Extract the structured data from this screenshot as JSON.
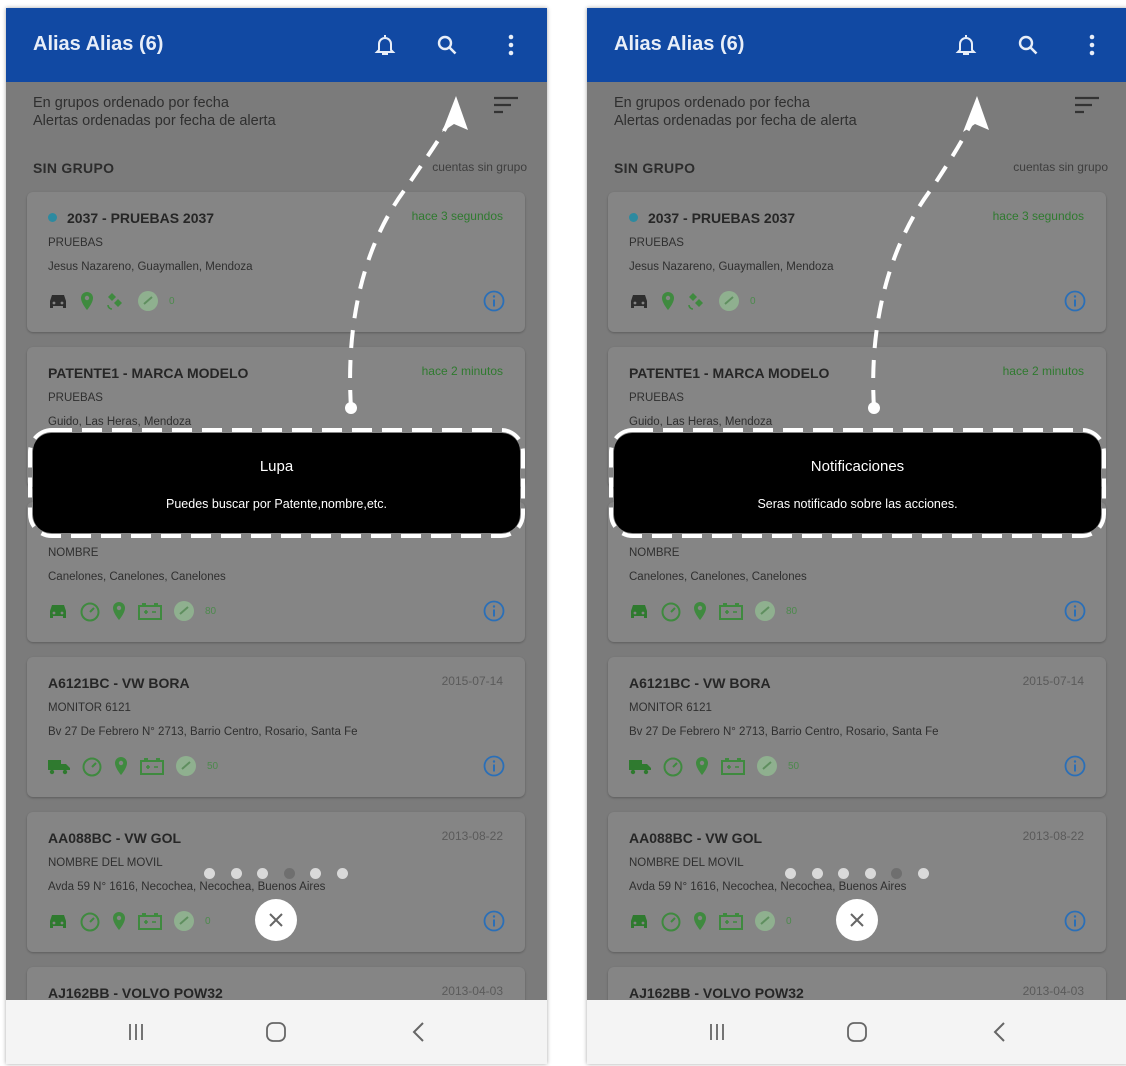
{
  "colors": {
    "appbar": "#1149a3",
    "recent_time": "#2f7a2f",
    "icon_green": "#3f8a3f",
    "info_blue": "#2a6fb8",
    "dot_blue": "#2d8aa0",
    "tooltip_bg": "#000000"
  },
  "screens": [
    {
      "appbar": {
        "title": "Alias Alias (6)",
        "icons": [
          "bell-icon",
          "search-icon",
          "more-vert-icon"
        ]
      },
      "sort_line1": "En grupos ordenado por fecha",
      "sort_line2": "Alertas ordenadas por fecha de alerta",
      "section_title": "SIN GRUPO",
      "section_right": "cuentas sin grupo",
      "cards": [
        {
          "title": "2037 - PRUEBAS 2037",
          "time": "hace 3 segundos",
          "sub": "PRUEBAS",
          "addr": "Jesus Nazareno, Guaymallen, Mendoza",
          "icon_count": "0"
        },
        {
          "title": "PATENTE1 - MARCA MODELO",
          "time": "hace 2 minutos",
          "sub": "PRUEBAS",
          "addr": "Guido, Las Heras, Mendoza",
          "icon_count": ""
        },
        {
          "title": "",
          "time": "",
          "sub": "NOMBRE",
          "addr": "Canelones, Canelones, Canelones",
          "icon_count": "80"
        },
        {
          "title": "A6121BC - VW BORA",
          "time": "2015-07-14",
          "sub": "MONITOR 6121",
          "addr": "Bv 27 De Febrero N° 2713, Barrio Centro, Rosario, Santa Fe",
          "icon_count": "50"
        },
        {
          "title": "AA088BC - VW GOL",
          "time": "2013-08-22",
          "sub": "NOMBRE DEL MOVIL",
          "addr": "Avda 59 N° 1616, Necochea, Necochea, Buenos Aires",
          "icon_count": "0"
        },
        {
          "title": "AJ162BB - VOLVO POW32",
          "time": "2013-04-03",
          "sub": "",
          "addr": "",
          "icon_count": ""
        }
      ],
      "tooltip": {
        "title": "Lupa",
        "text": "Puedes buscar por Patente,nombre,etc."
      },
      "tour_step": 4,
      "tour_steps_total": 6
    },
    {
      "appbar": {
        "title": "Alias Alias (6)",
        "icons": [
          "bell-icon",
          "search-icon",
          "more-vert-icon"
        ]
      },
      "sort_line1": "En grupos ordenado por fecha",
      "sort_line2": "Alertas ordenadas por fecha de alerta",
      "section_title": "SIN GRUPO",
      "section_right": "cuentas sin grupo",
      "cards": [
        {
          "title": "2037 - PRUEBAS 2037",
          "time": "hace 3 segundos",
          "sub": "PRUEBAS",
          "addr": "Jesus Nazareno, Guaymallen, Mendoza",
          "icon_count": "0"
        },
        {
          "title": "PATENTE1 - MARCA MODELO",
          "time": "hace 2 minutos",
          "sub": "PRUEBAS",
          "addr": "Guido, Las Heras, Mendoza",
          "icon_count": ""
        },
        {
          "title": "",
          "time": "",
          "sub": "NOMBRE",
          "addr": "Canelones, Canelones, Canelones",
          "icon_count": "80"
        },
        {
          "title": "A6121BC - VW BORA",
          "time": "2015-07-14",
          "sub": "MONITOR 6121",
          "addr": "Bv 27 De Febrero N° 2713, Barrio Centro, Rosario, Santa Fe",
          "icon_count": "50"
        },
        {
          "title": "AA088BC - VW GOL",
          "time": "2013-08-22",
          "sub": "NOMBRE DEL MOVIL",
          "addr": "Avda 59 N° 1616, Necochea, Necochea, Buenos Aires",
          "icon_count": "0"
        },
        {
          "title": "AJ162BB - VOLVO POW32",
          "time": "2013-04-03",
          "sub": "",
          "addr": "",
          "icon_count": ""
        }
      ],
      "tooltip": {
        "title": "Notificaciones",
        "text": "Seras notificado sobre las acciones."
      },
      "tour_step": 5,
      "tour_steps_total": 6
    }
  ],
  "navbar": {
    "icons": [
      "recent-apps-icon",
      "home-icon",
      "back-icon"
    ]
  }
}
